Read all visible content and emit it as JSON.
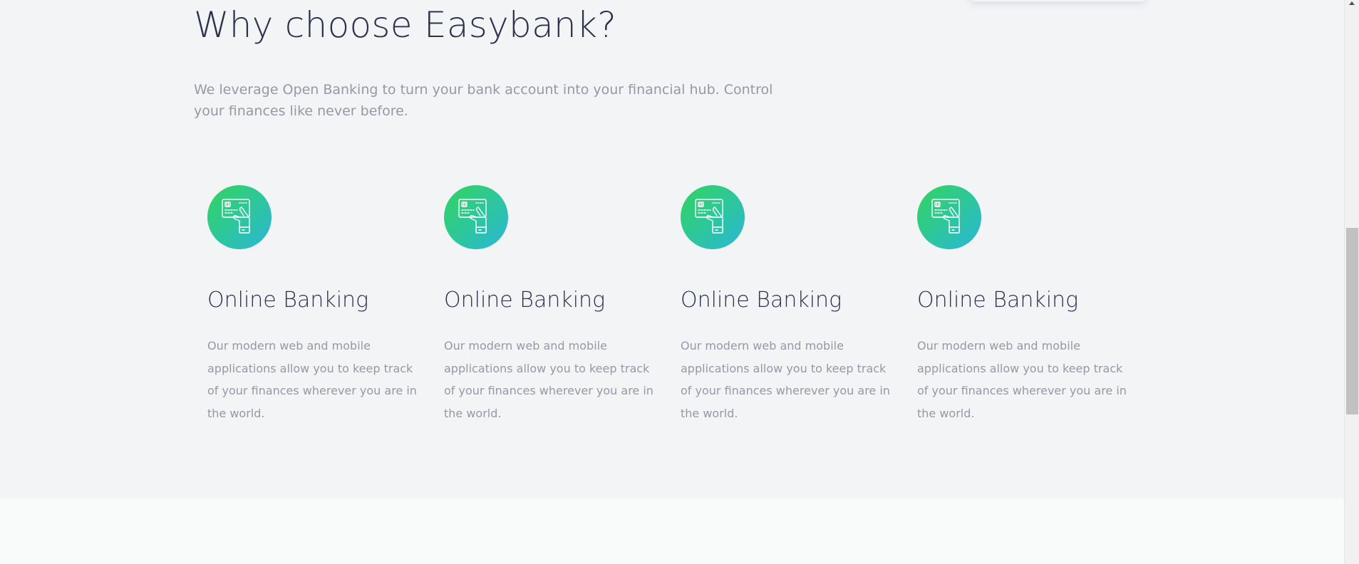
{
  "why": {
    "heading": "Why choose Easybank?",
    "subtitle": "We leverage Open Banking to turn your bank account into your financial hub. Control your finances like never before."
  },
  "features": [
    {
      "icon": "online-banking-card-icon",
      "title": "Online Banking",
      "text": "Our modern web and mobile applications allow you to keep track of your finances wherever you are in the world."
    },
    {
      "icon": "online-banking-card-icon",
      "title": "Online Banking",
      "text": "Our modern web and mobile applications allow you to keep track of your finances wherever you are in the world."
    },
    {
      "icon": "online-banking-card-icon",
      "title": "Online Banking",
      "text": "Our modern web and mobile applications allow you to keep track of your finances wherever you are in the world."
    },
    {
      "icon": "online-banking-card-icon",
      "title": "Online Banking",
      "text": "Our modern web and mobile applications allow you to keep track of your finances wherever you are in the world."
    }
  ],
  "colors": {
    "heading": "#2d314d",
    "body_text": "#9698a6",
    "section_background": "#f2f4f6",
    "next_section_background": "#f9fafa",
    "icon_gradient_start": "#33d35e",
    "icon_gradient_end": "#2ab6d9"
  }
}
